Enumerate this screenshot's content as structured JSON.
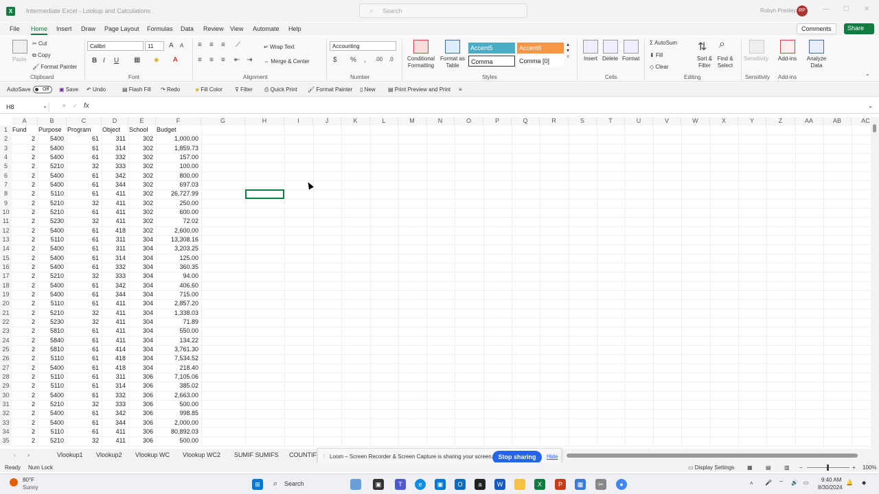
{
  "window": {
    "title": "Intermediate Excel - Lookup and Calculations",
    "search_placeholder": "Search",
    "user_name": "Robyn Presley",
    "user_initials": "RP"
  },
  "menu": {
    "items": [
      "File",
      "Home",
      "Insert",
      "Draw",
      "Page Layout",
      "Formulas",
      "Data",
      "Review",
      "View",
      "Automate",
      "Help"
    ],
    "comments_label": "Comments",
    "share_label": "Share"
  },
  "ribbon": {
    "clipboard": {
      "paste": "Paste",
      "cut": "Cut",
      "copy": "Copy",
      "format_painter": "Format Painter",
      "group": "Clipboard"
    },
    "font": {
      "name": "Calibri",
      "size": "11",
      "group": "Font"
    },
    "alignment": {
      "wrap": "Wrap Text",
      "merge": "Merge & Center",
      "group": "Alignment"
    },
    "number": {
      "format": "Accounting",
      "group": "Number"
    },
    "styles": {
      "cond_fmt": "Conditional Formatting",
      "fmt_table": "Format as Table",
      "accent5": "Accent5",
      "accent6": "Accent6",
      "comma": "Comma",
      "comma0": "Comma [0]",
      "group": "Styles"
    },
    "cells": {
      "insert": "Insert",
      "delete": "Delete",
      "format": "Format",
      "group": "Cells"
    },
    "editing": {
      "autosum": "AutoSum",
      "fill": "Fill",
      "clear": "Clear",
      "sort": "Sort & Filter",
      "find": "Find & Select",
      "group": "Editing"
    },
    "sensitivity": {
      "label": "Sensitivity",
      "group": "Sensitivity"
    },
    "addins": {
      "label": "Add-ins",
      "group": "Add-ins"
    },
    "analyze": {
      "label": "Analyze Data"
    }
  },
  "qat": {
    "autosave": "AutoSave",
    "toggle": "Off",
    "save": "Save",
    "undo": "Undo",
    "flash_fill": "Flash Fill",
    "redo": "Redo",
    "fill_color": "Fill Color",
    "filter": "Filter",
    "quick_print": "Quick Print",
    "format_painter": "Format Painter",
    "new": "New",
    "print_preview": "Print Preview and Print"
  },
  "formula_bar": {
    "name_box": "H8",
    "fx": "fx",
    "value": ""
  },
  "columns": [
    "A",
    "B",
    "C",
    "D",
    "E",
    "F",
    "G",
    "H",
    "I",
    "J",
    "K",
    "L",
    "M",
    "N",
    "O",
    "P",
    "Q",
    "R",
    "S",
    "T",
    "U",
    "V",
    "W",
    "X",
    "Y",
    "Z",
    "AA",
    "AB",
    "AC"
  ],
  "header_row": [
    "Fund",
    "Purpose",
    "Program",
    "Object",
    "School",
    "Budget"
  ],
  "rows": [
    [
      "2",
      "5400",
      "61",
      "311",
      "302",
      "1,000.00"
    ],
    [
      "2",
      "5400",
      "61",
      "314",
      "302",
      "1,859.73"
    ],
    [
      "2",
      "5400",
      "61",
      "332",
      "302",
      "157.00"
    ],
    [
      "2",
      "5210",
      "32",
      "333",
      "302",
      "100.00"
    ],
    [
      "2",
      "5400",
      "61",
      "342",
      "302",
      "800.00"
    ],
    [
      "2",
      "5400",
      "61",
      "344",
      "302",
      "697.03"
    ],
    [
      "2",
      "5110",
      "61",
      "411",
      "302",
      "26,727.99"
    ],
    [
      "2",
      "5210",
      "32",
      "411",
      "302",
      "250.00"
    ],
    [
      "2",
      "5210",
      "61",
      "411",
      "302",
      "600.00"
    ],
    [
      "2",
      "5230",
      "32",
      "411",
      "302",
      "72.02"
    ],
    [
      "2",
      "5400",
      "61",
      "418",
      "302",
      "2,600.00"
    ],
    [
      "2",
      "5110",
      "61",
      "311",
      "304",
      "13,308.16"
    ],
    [
      "2",
      "5400",
      "61",
      "311",
      "304",
      "3,203.25"
    ],
    [
      "2",
      "5400",
      "61",
      "314",
      "304",
      "125.00"
    ],
    [
      "2",
      "5400",
      "61",
      "332",
      "304",
      "360.35"
    ],
    [
      "2",
      "5210",
      "32",
      "333",
      "304",
      "94.00"
    ],
    [
      "2",
      "5400",
      "61",
      "342",
      "304",
      "406.60"
    ],
    [
      "2",
      "5400",
      "61",
      "344",
      "304",
      "715.00"
    ],
    [
      "2",
      "5110",
      "61",
      "411",
      "304",
      "2,857.20"
    ],
    [
      "2",
      "5210",
      "32",
      "411",
      "304",
      "1,338.03"
    ],
    [
      "2",
      "5230",
      "32",
      "411",
      "304",
      "71.89"
    ],
    [
      "2",
      "5810",
      "61",
      "411",
      "304",
      "550.00"
    ],
    [
      "2",
      "5840",
      "61",
      "411",
      "304",
      "134.22"
    ],
    [
      "2",
      "5810",
      "61",
      "414",
      "304",
      "3,761.30"
    ],
    [
      "2",
      "5110",
      "61",
      "418",
      "304",
      "7,534.52"
    ],
    [
      "2",
      "5400",
      "61",
      "418",
      "304",
      "218.40"
    ],
    [
      "2",
      "5110",
      "61",
      "311",
      "306",
      "7,105.06"
    ],
    [
      "2",
      "5110",
      "61",
      "314",
      "306",
      "385.02"
    ],
    [
      "2",
      "5400",
      "61",
      "332",
      "306",
      "2,663.00"
    ],
    [
      "2",
      "5210",
      "32",
      "333",
      "306",
      "500.00"
    ],
    [
      "2",
      "5400",
      "61",
      "342",
      "306",
      "998.85"
    ],
    [
      "2",
      "5400",
      "61",
      "344",
      "306",
      "2,000.00"
    ],
    [
      "2",
      "5110",
      "61",
      "411",
      "306",
      "80,892.03"
    ],
    [
      "2",
      "5210",
      "32",
      "411",
      "306",
      "500.00"
    ]
  ],
  "sheet_tabs": [
    "Vlookup1",
    "Vlookup2",
    "Vlookup WC",
    "Vlookup WC2",
    "SUMIF SUMIFS",
    "COUNTIF"
  ],
  "loom": {
    "message": "Loom – Screen Recorder & Screen Capture is sharing your screen.",
    "stop": "Stop sharing",
    "hide": "Hide"
  },
  "status": {
    "ready": "Ready",
    "numlock": "Num Lock",
    "display": "Display Settings",
    "zoom": "100%"
  },
  "taskbar": {
    "temp": "80°F",
    "weather": "Sunny",
    "search": "Search",
    "time": "9:40 AM",
    "date": "8/30/2024"
  }
}
